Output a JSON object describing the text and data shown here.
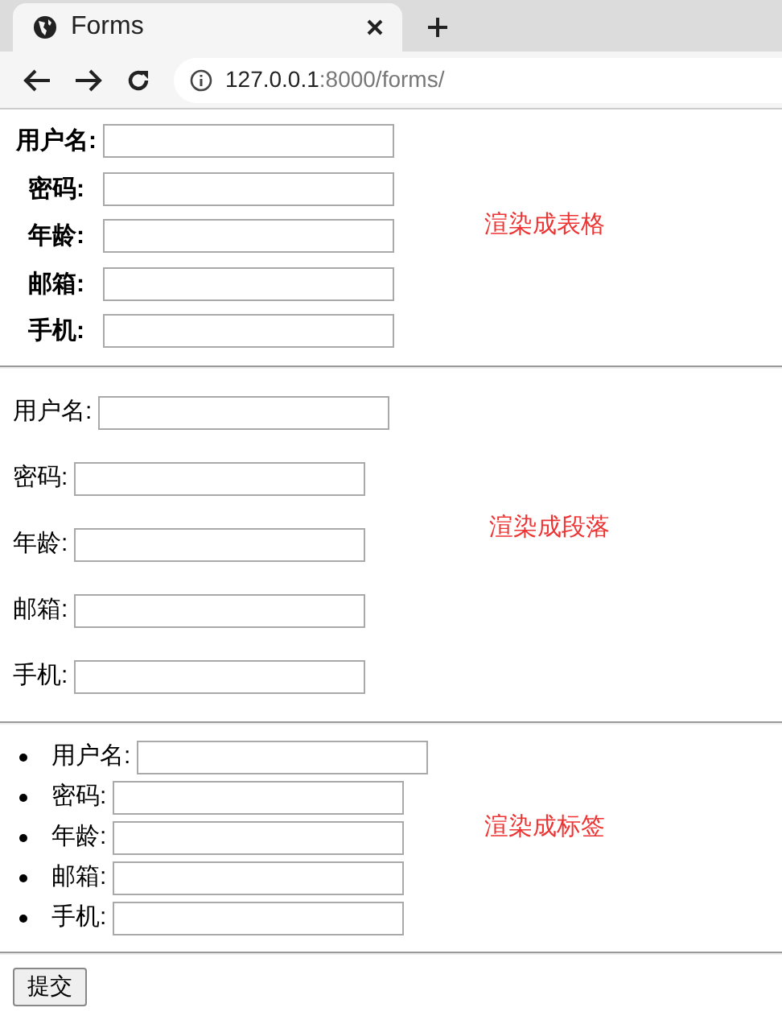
{
  "browser": {
    "tab_title": "Forms",
    "url_host": "127.0.0.1",
    "url_path": ":8000/forms/"
  },
  "sections": [
    {
      "kind": "table",
      "fields": [
        "用户名:",
        "密码:",
        "年龄:",
        "邮箱:",
        "手机:"
      ],
      "note": "渲染成表格"
    },
    {
      "kind": "paragraphs",
      "fields": [
        "用户名:",
        "密码:",
        "年龄:",
        "邮箱:",
        "手机:"
      ],
      "note": "渲染成段落"
    },
    {
      "kind": "list",
      "fields": [
        "用户名:",
        "密码:",
        "年龄:",
        "邮箱:",
        "手机:"
      ],
      "note": "渲染成标签"
    }
  ],
  "submit": "提交"
}
